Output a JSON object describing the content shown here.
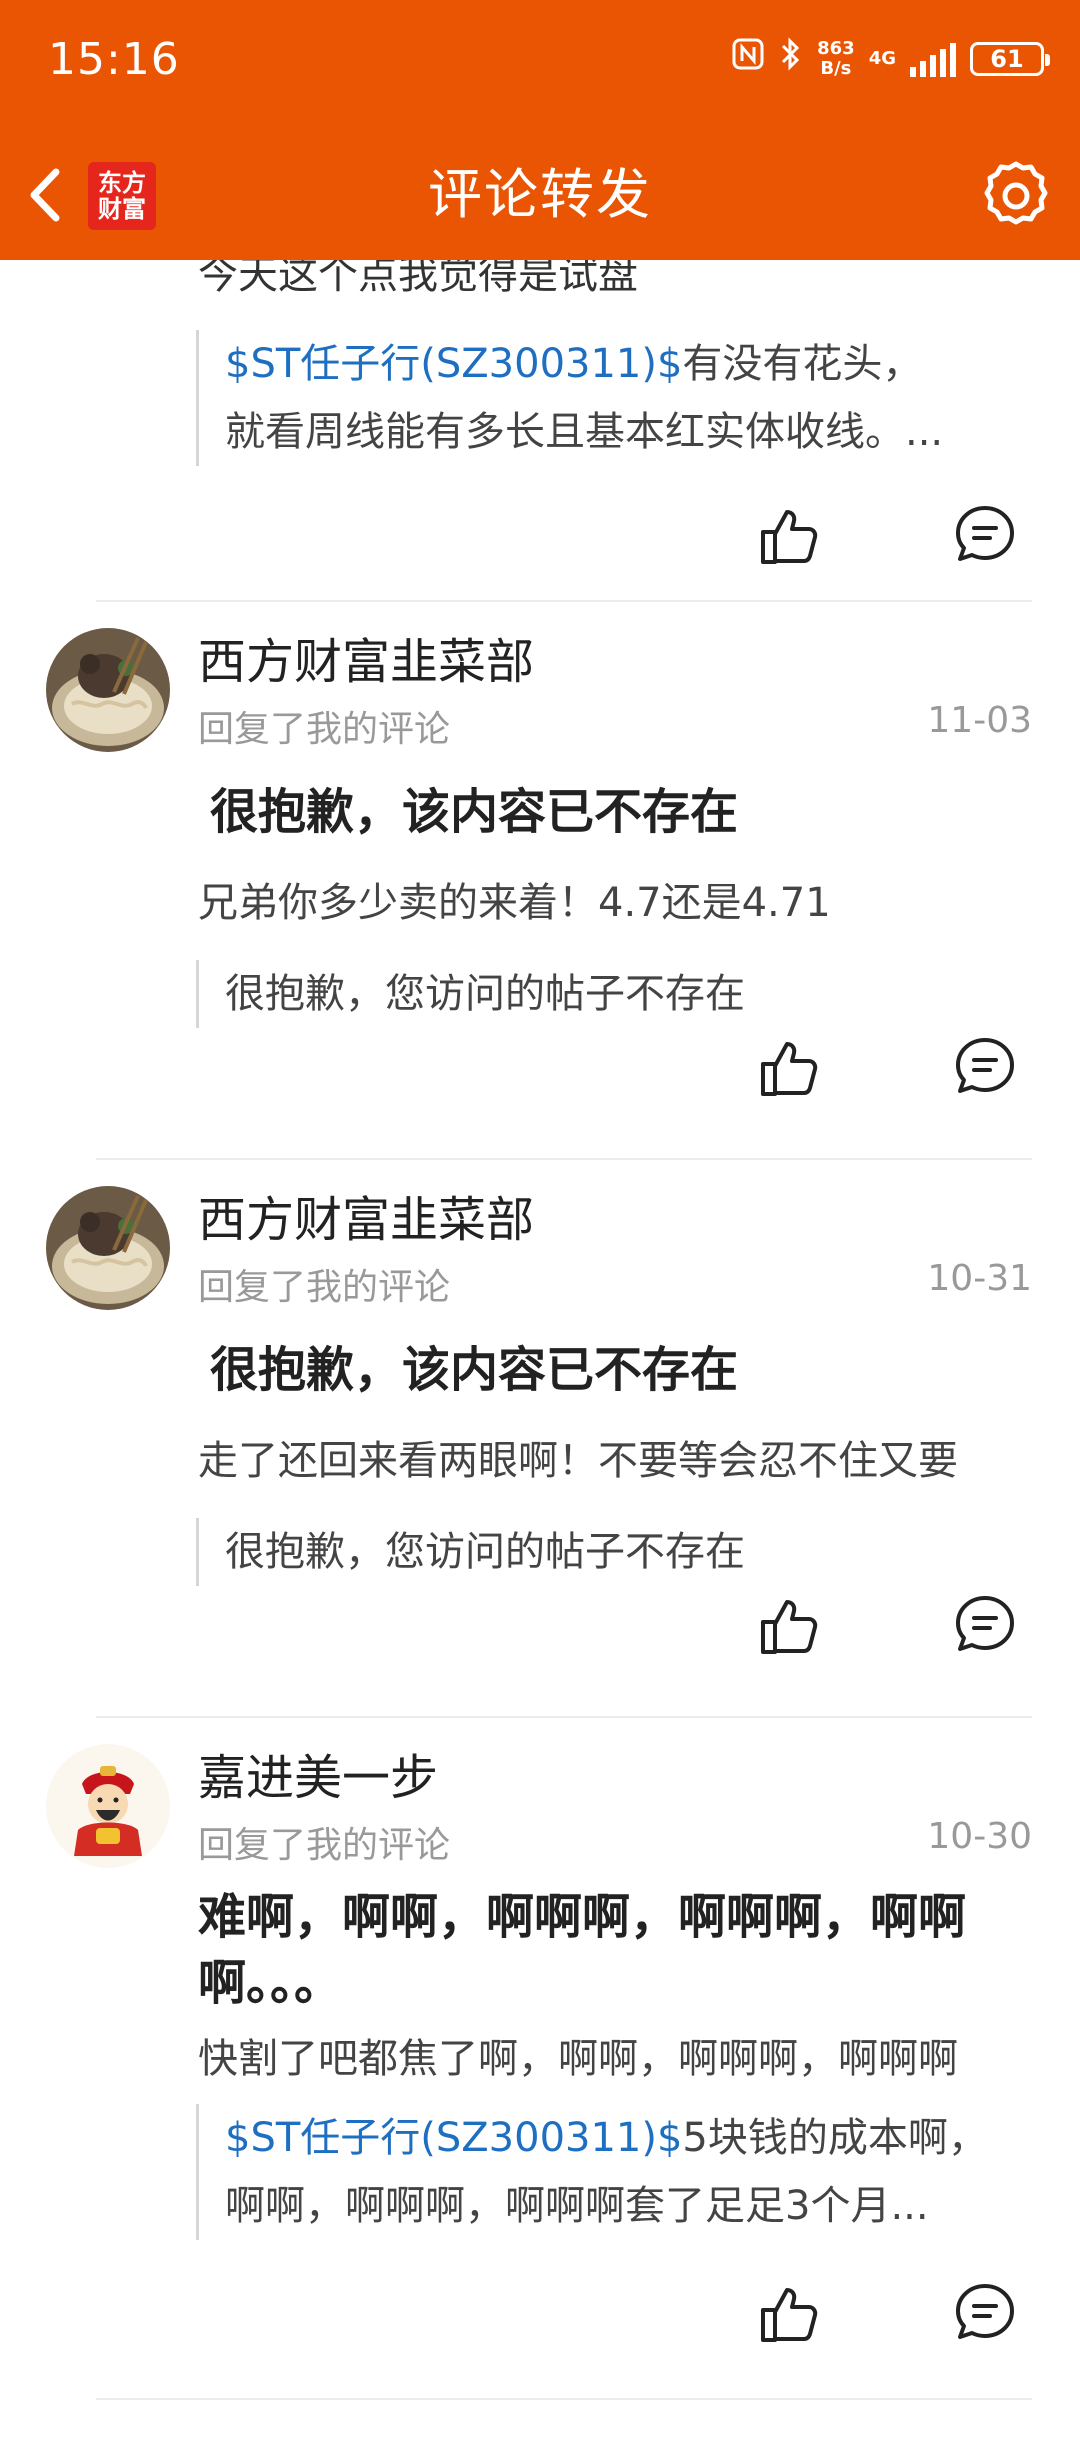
{
  "status_bar": {
    "time": "15:16",
    "net_speed_value": "863",
    "net_speed_unit": "B/s",
    "network": "4G",
    "battery": "61"
  },
  "header": {
    "logo_line1": "东方",
    "logo_line2": "财富",
    "title": "评论转发"
  },
  "feed": {
    "first_partial": {
      "cut_text": "今天这个点我觉得是试盘",
      "quote_stock": "$ST任子行(SZ300311)$",
      "quote_line1": "有没有花头，",
      "quote_line2": "就看周线能有多长且基本红实体收线。..."
    },
    "items": [
      {
        "username": "西方财富韭菜部",
        "subline": "回复了我的评论",
        "date": "11-03",
        "title": "很抱歉，该内容已不存在",
        "text": "兄弟你多少卖的来着！4.7还是4.71",
        "quote": "很抱歉，您访问的帖子不存在"
      },
      {
        "username": "西方财富韭菜部",
        "subline": "回复了我的评论",
        "date": "10-31",
        "title": "很抱歉，该内容已不存在",
        "text": "走了还回来看两眼啊！不要等会忍不住又要",
        "quote": "很抱歉，您访问的帖子不存在"
      },
      {
        "username": "嘉进美一步",
        "subline": "回复了我的评论",
        "date": "10-30",
        "title": "难啊，啊啊，啊啊啊，啊啊啊，啊啊啊。。。",
        "text": "快割了吧都焦了啊，啊啊，啊啊啊，啊啊啊",
        "quote_stock": "$ST任子行(SZ300311)$",
        "quote_line1": "5块钱的成本啊，",
        "quote_line2": "啊啊，啊啊啊，啊啊啊套了足足3个月..."
      }
    ]
  },
  "colors": {
    "brand": "#EA5504",
    "stock_link": "#1E6FC2"
  },
  "icons": [
    "back-arrow-icon",
    "settings-gear-icon",
    "like-thumb-icon",
    "comment-bubble-icon"
  ]
}
